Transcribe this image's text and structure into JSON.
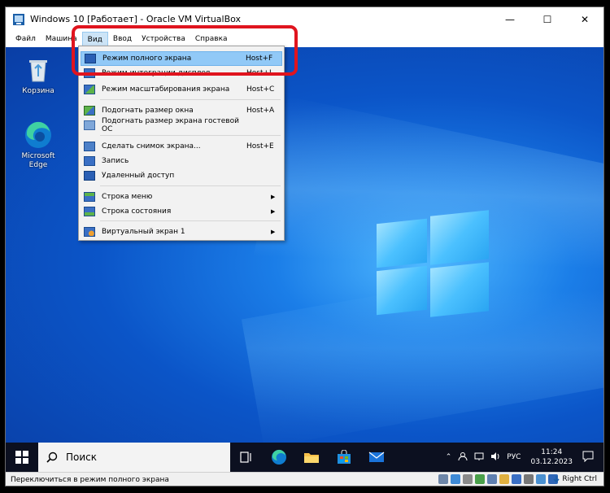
{
  "window": {
    "title": "Windows 10 [Работает] - Oracle VM VirtualBox",
    "minimize": "—",
    "maximize": "☐",
    "close": "✕"
  },
  "menubar": {
    "items": [
      "Файл",
      "Машина",
      "Вид",
      "Ввод",
      "Устройства",
      "Справка"
    ]
  },
  "desktop_icons": [
    {
      "label": "Корзина",
      "icon": "recycle-bin-icon"
    },
    {
      "label": "Microsoft Edge",
      "icon": "edge-icon"
    }
  ],
  "view_menu": {
    "items": [
      {
        "label": "Режим полного экрана",
        "shortcut": "Host+F",
        "highlighted": true
      },
      {
        "label": "Режим интеграции дисплея",
        "shortcut": "Host+L"
      },
      {
        "label": "Режим масштабирования экрана",
        "shortcut": "Host+C"
      },
      {
        "label": "Подогнать размер окна",
        "shortcut": "Host+A"
      },
      {
        "label": "Подогнать размер экрана гостевой ОС",
        "shortcut": ""
      },
      {
        "label": "Сделать снимок экрана...",
        "shortcut": "Host+E"
      },
      {
        "label": "Запись",
        "shortcut": ""
      },
      {
        "label": "Удаленный доступ",
        "shortcut": ""
      },
      {
        "label": "Строка меню",
        "shortcut": "",
        "submenu": true
      },
      {
        "label": "Строка состояния",
        "shortcut": "",
        "submenu": true
      },
      {
        "label": "Виртуальный экран 1",
        "shortcut": "",
        "submenu": true
      }
    ],
    "submenu_arrow": "▶"
  },
  "taskbar": {
    "search_placeholder": "Поиск",
    "language": "РУС",
    "time": "11:24",
    "date": "03.12.2023",
    "tray_chevron": "⌃"
  },
  "statusbar": {
    "text": "Переключиться в режим полного экрана",
    "host_key": "Right Ctrl"
  },
  "colors": {
    "highlight_box": "#e0141e",
    "menu_highlight": "#91c9f7",
    "taskbar": "#0c1020"
  }
}
